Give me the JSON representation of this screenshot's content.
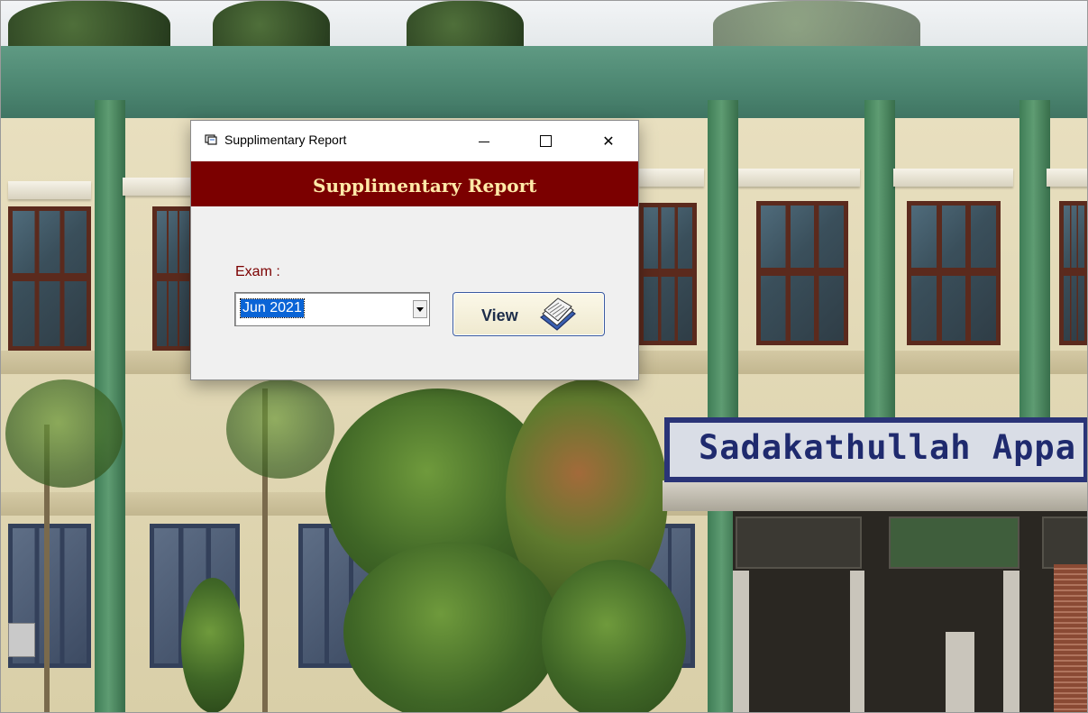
{
  "background": {
    "sign_text": "Sadakathullah Appa C"
  },
  "dialog": {
    "window_title": "Supplimentary Report",
    "window_icon": "report-window-icon",
    "controls": {
      "minimize_icon": "minimize-icon",
      "maximize_icon": "maximize-icon",
      "close_glyph": "✕"
    },
    "header_title": "Supplimentary Report",
    "header_color": "#7b0000",
    "exam_label": "Exam :",
    "exam_selected": "Jun 2021",
    "view_button_label": "View",
    "view_button_icon": "book-icon"
  }
}
